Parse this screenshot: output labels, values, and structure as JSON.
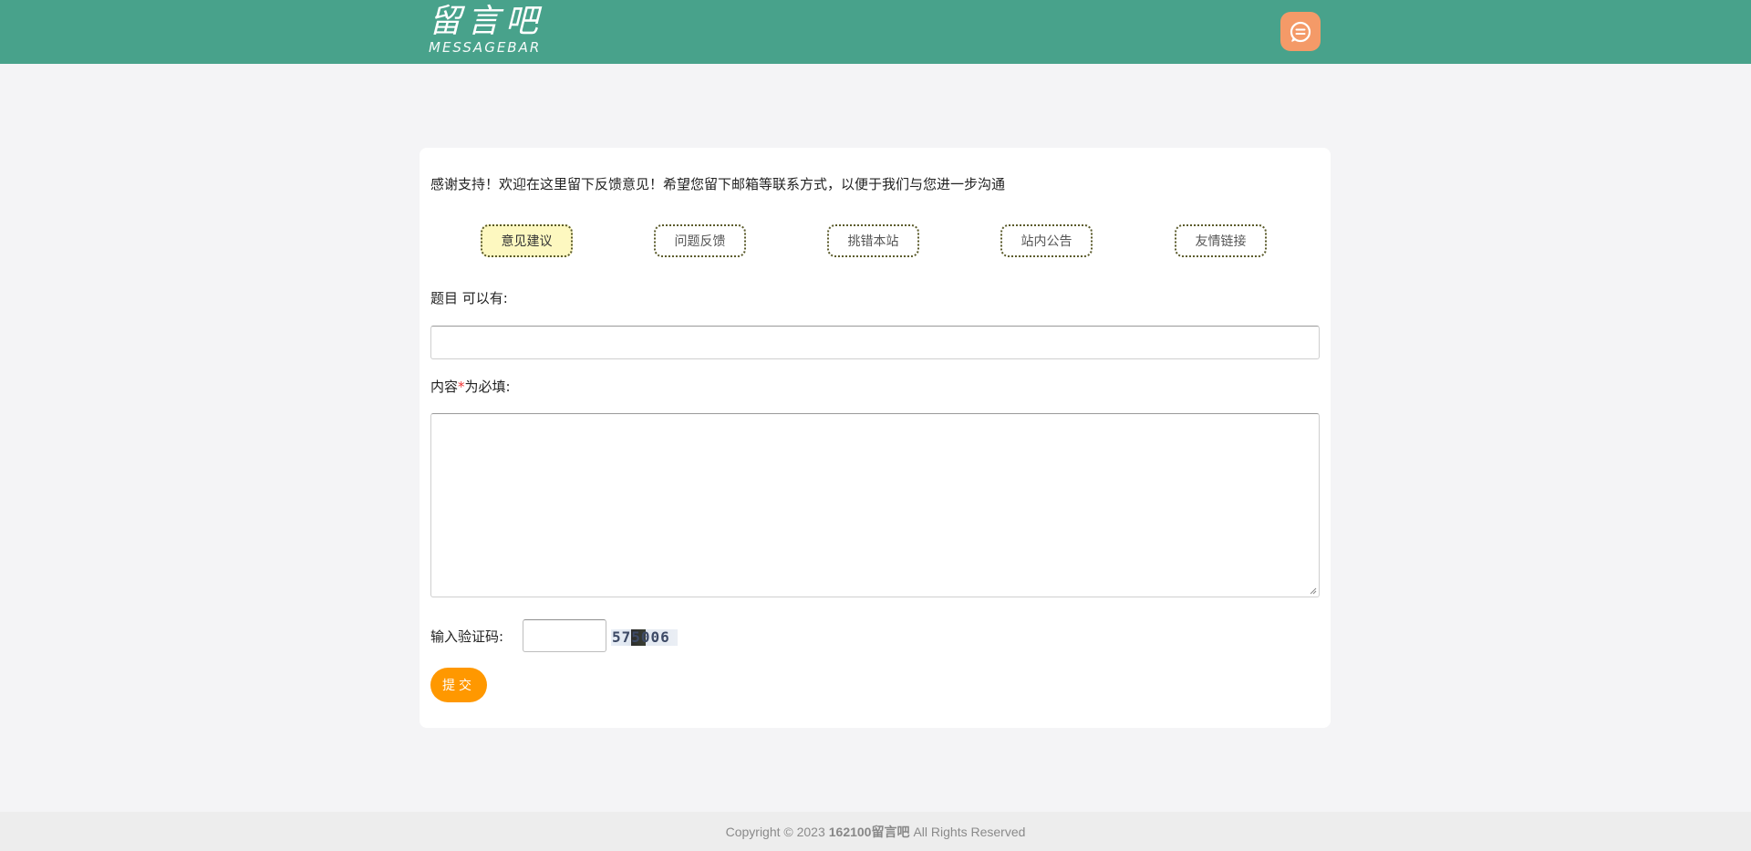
{
  "header": {
    "logo_cn": "留言吧",
    "logo_en": "MESSAGEBAR",
    "message_icon": "chat-bubble-icon",
    "colors": {
      "bar": "#48a28b",
      "icon_bg": "#f49a68"
    }
  },
  "form": {
    "intro": "感谢支持！欢迎在这里留下反馈意见！希望您留下邮箱等联系方式，以便于我们与您进一步沟通",
    "tabs": [
      {
        "label": "意见建议",
        "active": true
      },
      {
        "label": "问题反馈",
        "active": false
      },
      {
        "label": "挑错本站",
        "active": false
      },
      {
        "label": "站内公告",
        "active": false
      },
      {
        "label": "友情链接",
        "active": false
      }
    ],
    "title_label": "题目 可以有:",
    "title_value": "",
    "content_label_prefix": "内容",
    "content_required_mark": "*",
    "content_label_suffix": "为必填:",
    "content_value": "",
    "captcha_label": "输入验证码:",
    "captcha_value": "",
    "captcha_code": "575006",
    "submit_label": "提交",
    "colors": {
      "submit": "#ff9800",
      "active_tab": "#fdf8c0"
    }
  },
  "footer": {
    "prefix": "Copyright © 2023",
    "site": "162100留言吧",
    "suffix": "All Rights Reserved"
  }
}
